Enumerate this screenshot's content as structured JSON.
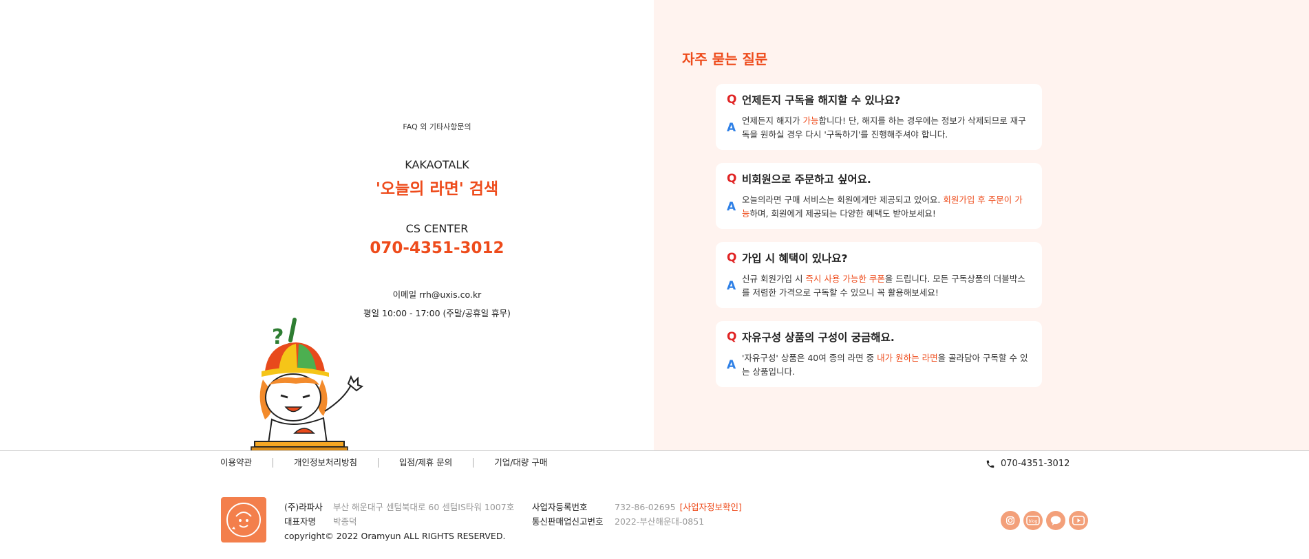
{
  "contact": {
    "heading": "FAQ 외 기타사항문의",
    "kakao_title": "KAKAOTALK",
    "kakao_search": "'오늘의 라면' 검색",
    "center_title": "CS CENTER",
    "center_phone": "070-4351-3012",
    "email": "이메일 rrh@uxis.co.kr",
    "hours": "평일 10:00 - 17:00 (주말/공휴일 휴무)"
  },
  "faq": {
    "title": "자주 묻는 질문",
    "q_mark": "Q",
    "a_mark": "A",
    "items": [
      {
        "question": "언제든지 구독을 해지할 수 있나요?",
        "answer_pre": "언제든지 해지가 ",
        "answer_hl": "가능",
        "answer_post": "합니다! 단, 해지를 하는 경우에는 정보가 삭제되므로 재구독을 원하실 경우 다시 '구독하기'를 진행해주셔야 합니다."
      },
      {
        "question": "비회원으로 주문하고 싶어요.",
        "answer_pre": "오늘의라면 구매 서비스는 회원에게만 제공되고 있어요. ",
        "answer_hl": "회원가입 후 주문이 가능",
        "answer_post": "하며, 회원에게 제공되는 다양한 혜택도 받아보세요!"
      },
      {
        "question": "가입 시 혜택이 있나요?",
        "answer_pre": "신규 회원가입 시 ",
        "answer_hl": "즉시 사용 가능한 쿠폰",
        "answer_post": "을 드립니다. 모든 구독상품의 더블박스를 저렴한 가격으로 구독할 수 있으니 꼭 활용해보세요!"
      },
      {
        "question": "자유구성 상품의 구성이 궁금해요.",
        "answer_pre": "'자유구성' 상품은 40여 종의 라면 중 ",
        "answer_hl": "내가 원하는 라면",
        "answer_post": "을 골라담아 구독할 수 있는 상품입니다."
      }
    ]
  },
  "footer": {
    "links": [
      "이용약관",
      "개인정보처리방침",
      "입점/제휴 문의",
      "기업/대량 구매"
    ],
    "phone": "070-4351-3012",
    "company_label": "(주)라파사",
    "address": "부산 해운대구 센텀북대로 60 센텀IS타워 1007호",
    "ceo_label": "대표자명",
    "ceo": "박종덕",
    "copyright": "copyright© 2022 Oramyun ALL RIGHTS RESERVED.",
    "biz_no_label": "사업자등록번호",
    "biz_no": "732-86-02695",
    "biz_info_link": "[사업자정보확인]",
    "mail_order_label": "통신판매업신고번호",
    "mail_order": "2022-부산해운대-0851",
    "blog_icon_text": "blog"
  },
  "icons": [
    "phone-icon",
    "instagram-icon",
    "blog-icon",
    "kakao-talk-icon",
    "youtube-icon"
  ],
  "colors": {
    "accent": "#ee4b1b",
    "question": "#e02424",
    "answer": "#2f80e6",
    "faq_bg": "#fff3ef",
    "social": "#f3a07a"
  }
}
